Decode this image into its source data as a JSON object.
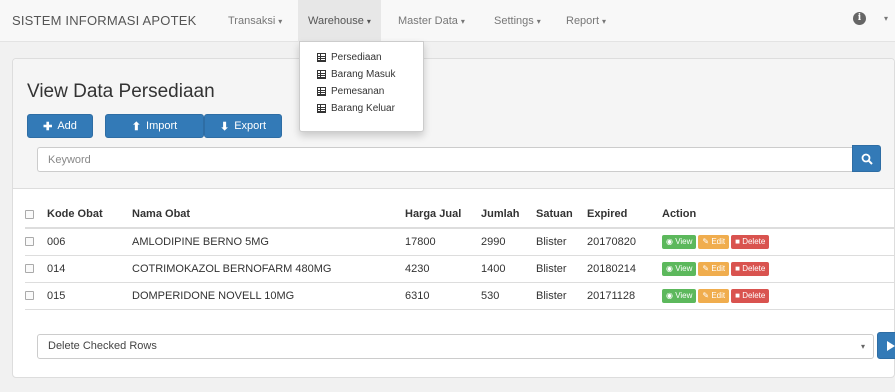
{
  "navbar": {
    "brand": "SISTEM INFORMASI APOTEK",
    "menu": [
      {
        "label": "Transaksi"
      },
      {
        "label": "Warehouse"
      },
      {
        "label": "Master Data"
      },
      {
        "label": "Settings"
      },
      {
        "label": "Report"
      }
    ],
    "caret": "▾",
    "info_glyph": "i"
  },
  "dropdown": {
    "items": [
      "Persediaan",
      "Barang Masuk",
      "Pemesanan",
      "Barang Keluar"
    ]
  },
  "page": {
    "title": "View Data Persediaan",
    "buttons": {
      "add": {
        "icon": "plus-icon",
        "glyph": "✚",
        "label": "Add"
      },
      "import": {
        "icon": "import-icon",
        "glyph": "⬆",
        "label": "Import"
      },
      "export": {
        "icon": "export-icon",
        "glyph": "⬇",
        "label": "Export"
      }
    },
    "search": {
      "placeholder": "Keyword",
      "value": ""
    }
  },
  "table": {
    "columns": [
      "Kode Obat",
      "Nama Obat",
      "Harga Jual",
      "Jumlah",
      "Satuan",
      "Expired",
      "Action"
    ],
    "rows": [
      {
        "kode": "006",
        "nama": "AMLODIPINE BERNO 5MG",
        "harga": "17800",
        "jumlah": "2990",
        "satuan": "Blister",
        "expired": "20170820"
      },
      {
        "kode": "014",
        "nama": "COTRIMOKAZOL BERNOFARM 480MG",
        "harga": "4230",
        "jumlah": "1400",
        "satuan": "Blister",
        "expired": "20180214"
      },
      {
        "kode": "015",
        "nama": "DOMPERIDONE NOVELL 10MG",
        "harga": "6310",
        "jumlah": "530",
        "satuan": "Blister",
        "expired": "20171128"
      }
    ],
    "actions": {
      "view": "View",
      "edit": "Edit",
      "delete": "Delete"
    }
  },
  "bulk": {
    "selected": "Delete Checked Rows",
    "caret": "▾"
  },
  "colors": {
    "primary": "#337ab7",
    "success": "#5cb85c",
    "warning": "#f0ad4e",
    "danger": "#d9534f"
  }
}
